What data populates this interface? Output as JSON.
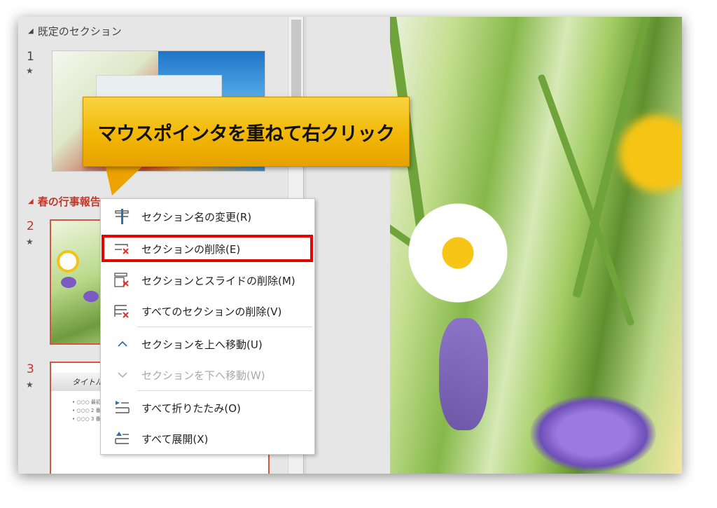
{
  "thumbnail_pane": {
    "section1": {
      "label": "既定のセクション"
    },
    "section2": {
      "label": "春の行事報告"
    },
    "slides": [
      {
        "number": "1",
        "star": "★"
      },
      {
        "number": "2",
        "star": "★"
      },
      {
        "number": "3",
        "star": "★"
      }
    ],
    "slide3": {
      "title": "タイトル",
      "bullets": [
        "• ○○○ 最初の…",
        "• ○○○ 2 番…",
        "• ○○○ 3 番…"
      ]
    }
  },
  "callout": {
    "text": "マウスポインタを重ねて右クリック"
  },
  "context_menu": {
    "items": [
      {
        "label": "セクション名の変更(R)",
        "icon": "rename-section-icon",
        "enabled": true
      },
      {
        "label": "セクションの削除(E)",
        "icon": "delete-section-icon",
        "enabled": true,
        "highlighted": true
      },
      {
        "label": "セクションとスライドの削除(M)",
        "icon": "delete-section-slides-icon",
        "enabled": true
      },
      {
        "label": "すべてのセクションの削除(V)",
        "icon": "delete-all-sections-icon",
        "enabled": true
      },
      {
        "label": "セクションを上へ移動(U)",
        "icon": "chevron-up-icon",
        "enabled": true
      },
      {
        "label": "セクションを下へ移動(W)",
        "icon": "chevron-down-icon",
        "enabled": false
      },
      {
        "label": "すべて折りたたみ(O)",
        "icon": "collapse-all-icon",
        "enabled": true
      },
      {
        "label": "すべて展開(X)",
        "icon": "expand-all-icon",
        "enabled": true
      }
    ]
  },
  "colors": {
    "accent_red": "#c0392b",
    "highlight_border": "#e10600",
    "callout_fill": "#f2b705",
    "icon_blue": "#2f6fb5",
    "icon_red": "#d9342b"
  }
}
